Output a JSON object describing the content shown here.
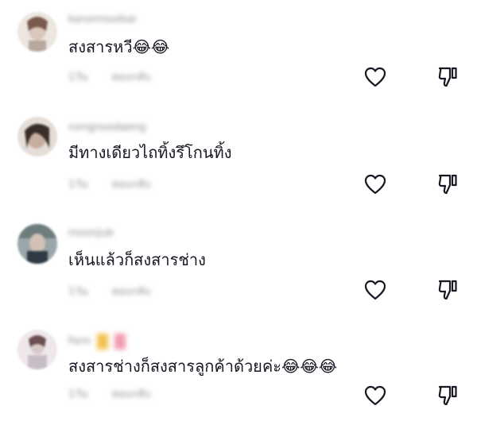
{
  "comments": [
    {
      "username": "kanomsodsai",
      "text": "สงสารหวี😂😂",
      "time": "1วัน",
      "reply_label": "ตอบกลับ",
      "avatar_colors": [
        "#d9c7be",
        "#7a5a4d",
        "#e9e2dc"
      ]
    },
    {
      "username": "nongnoodaeng",
      "text": "มีทางเดียวไถทิ้งรึโกนทิ้ง",
      "time": "1วัน",
      "reply_label": "ตอบกลับ",
      "avatar_colors": [
        "#b9a596",
        "#3a2d27",
        "#d7cbc2"
      ]
    },
    {
      "username": "moonjub",
      "text": "เห็นแล้วก็สงสารช่าง",
      "time": "1วัน",
      "reply_label": "ตอบกลับ",
      "avatar_colors": [
        "#8d9a9c",
        "#2e3a44",
        "#c6cdd3"
      ]
    },
    {
      "username": "Fern",
      "text": "สงสารช่างก็สงสารลูกค้าด้วยค่ะ😂😂😂",
      "time": "1วัน",
      "reply_label": "ตอบกลับ",
      "avatar_colors": [
        "#cdbfbf",
        "#6b4f53",
        "#e8e2e4"
      ]
    }
  ],
  "icons": {
    "like": "heart-outline-icon",
    "dislike": "thumbs-down-outline-icon"
  },
  "colors": {
    "text": "#161823",
    "muted": "#8a8b91",
    "icon": "#161823"
  }
}
